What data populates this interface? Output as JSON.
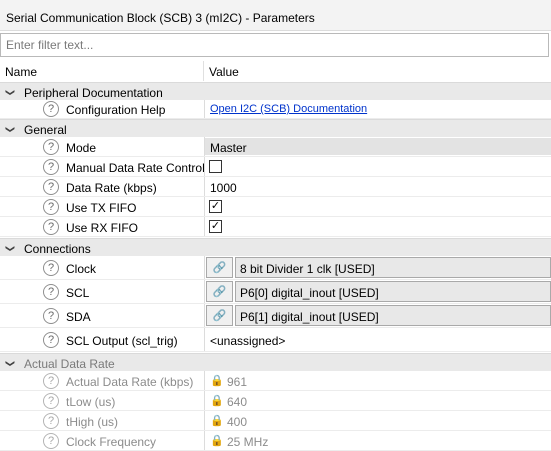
{
  "window": {
    "title": "Serial Communication Block (SCB) 3 (mI2C) - Parameters"
  },
  "filter": {
    "placeholder": "Enter filter text..."
  },
  "columns": {
    "name": "Name",
    "value": "Value"
  },
  "categories": {
    "peripheral_documentation": "Peripheral Documentation",
    "general": "General",
    "connections": "Connections",
    "actual_data_rate": "Actual Data Rate"
  },
  "params": {
    "configuration_help": {
      "label": "Configuration Help",
      "value": "Open I2C (SCB) Documentation"
    },
    "mode": {
      "label": "Mode",
      "value": "Master"
    },
    "manual_data_rate_control": {
      "label": "Manual Data Rate Control",
      "checked": false
    },
    "data_rate": {
      "label": "Data Rate (kbps)",
      "value": "1000"
    },
    "use_tx_fifo": {
      "label": "Use TX FIFO",
      "checked": true
    },
    "use_rx_fifo": {
      "label": "Use RX FIFO",
      "checked": true
    },
    "clock": {
      "label": "Clock",
      "value": "8 bit Divider 1 clk [USED]"
    },
    "scl": {
      "label": "SCL",
      "value": "P6[0] digital_inout [USED]"
    },
    "sda": {
      "label": "SDA",
      "value": "P6[1] digital_inout [USED]"
    },
    "scl_output": {
      "label": "SCL Output (scl_trig)",
      "value": "<unassigned>"
    },
    "actual_data_rate": {
      "label": "Actual Data Rate (kbps)",
      "value": "961"
    },
    "tlow": {
      "label": "tLow (us)",
      "value": "640"
    },
    "thigh": {
      "label": "tHigh (us)",
      "value": "400"
    },
    "clock_frequency": {
      "label": "Clock Frequency",
      "value": "25 MHz"
    }
  },
  "glyphs": {
    "help": "?",
    "expanded": "❯",
    "check": "✓",
    "link": "🔗",
    "lock": "🔒"
  }
}
